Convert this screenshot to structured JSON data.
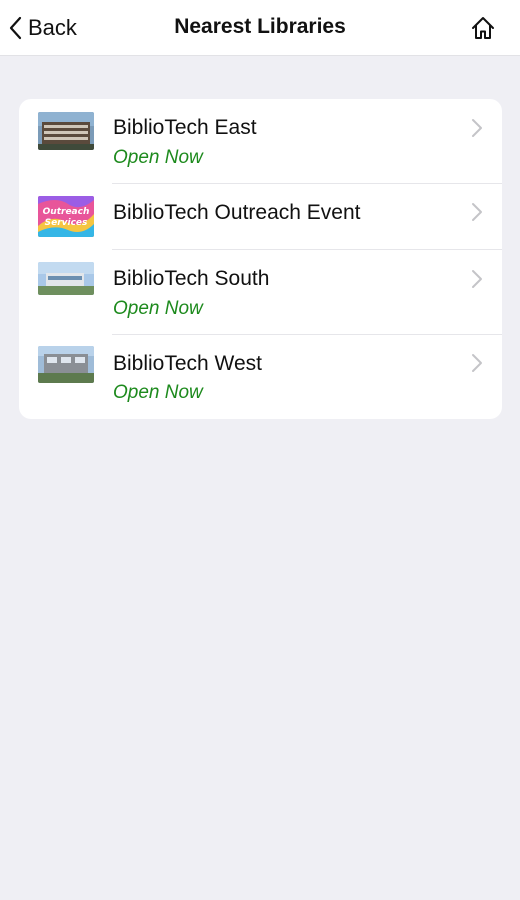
{
  "nav": {
    "back_label": "Back",
    "title": "Nearest Libraries",
    "home_icon": "home-icon"
  },
  "libraries": [
    {
      "name": "BiblioTech East",
      "status": "Open Now",
      "thumb": "building-photo"
    },
    {
      "name": "BiblioTech Outreach Event",
      "status": "",
      "thumb": "outreach-poster",
      "thumb_text_1": "Outreach",
      "thumb_text_2": "Services"
    },
    {
      "name": "BiblioTech South",
      "status": "Open Now",
      "thumb": "building-photo"
    },
    {
      "name": "BiblioTech West",
      "status": "Open Now",
      "thumb": "building-photo"
    }
  ],
  "colors": {
    "background": "#efeff4",
    "card": "#ffffff",
    "status_open": "#1d8a1d",
    "chevron": "#c4c4c8"
  }
}
